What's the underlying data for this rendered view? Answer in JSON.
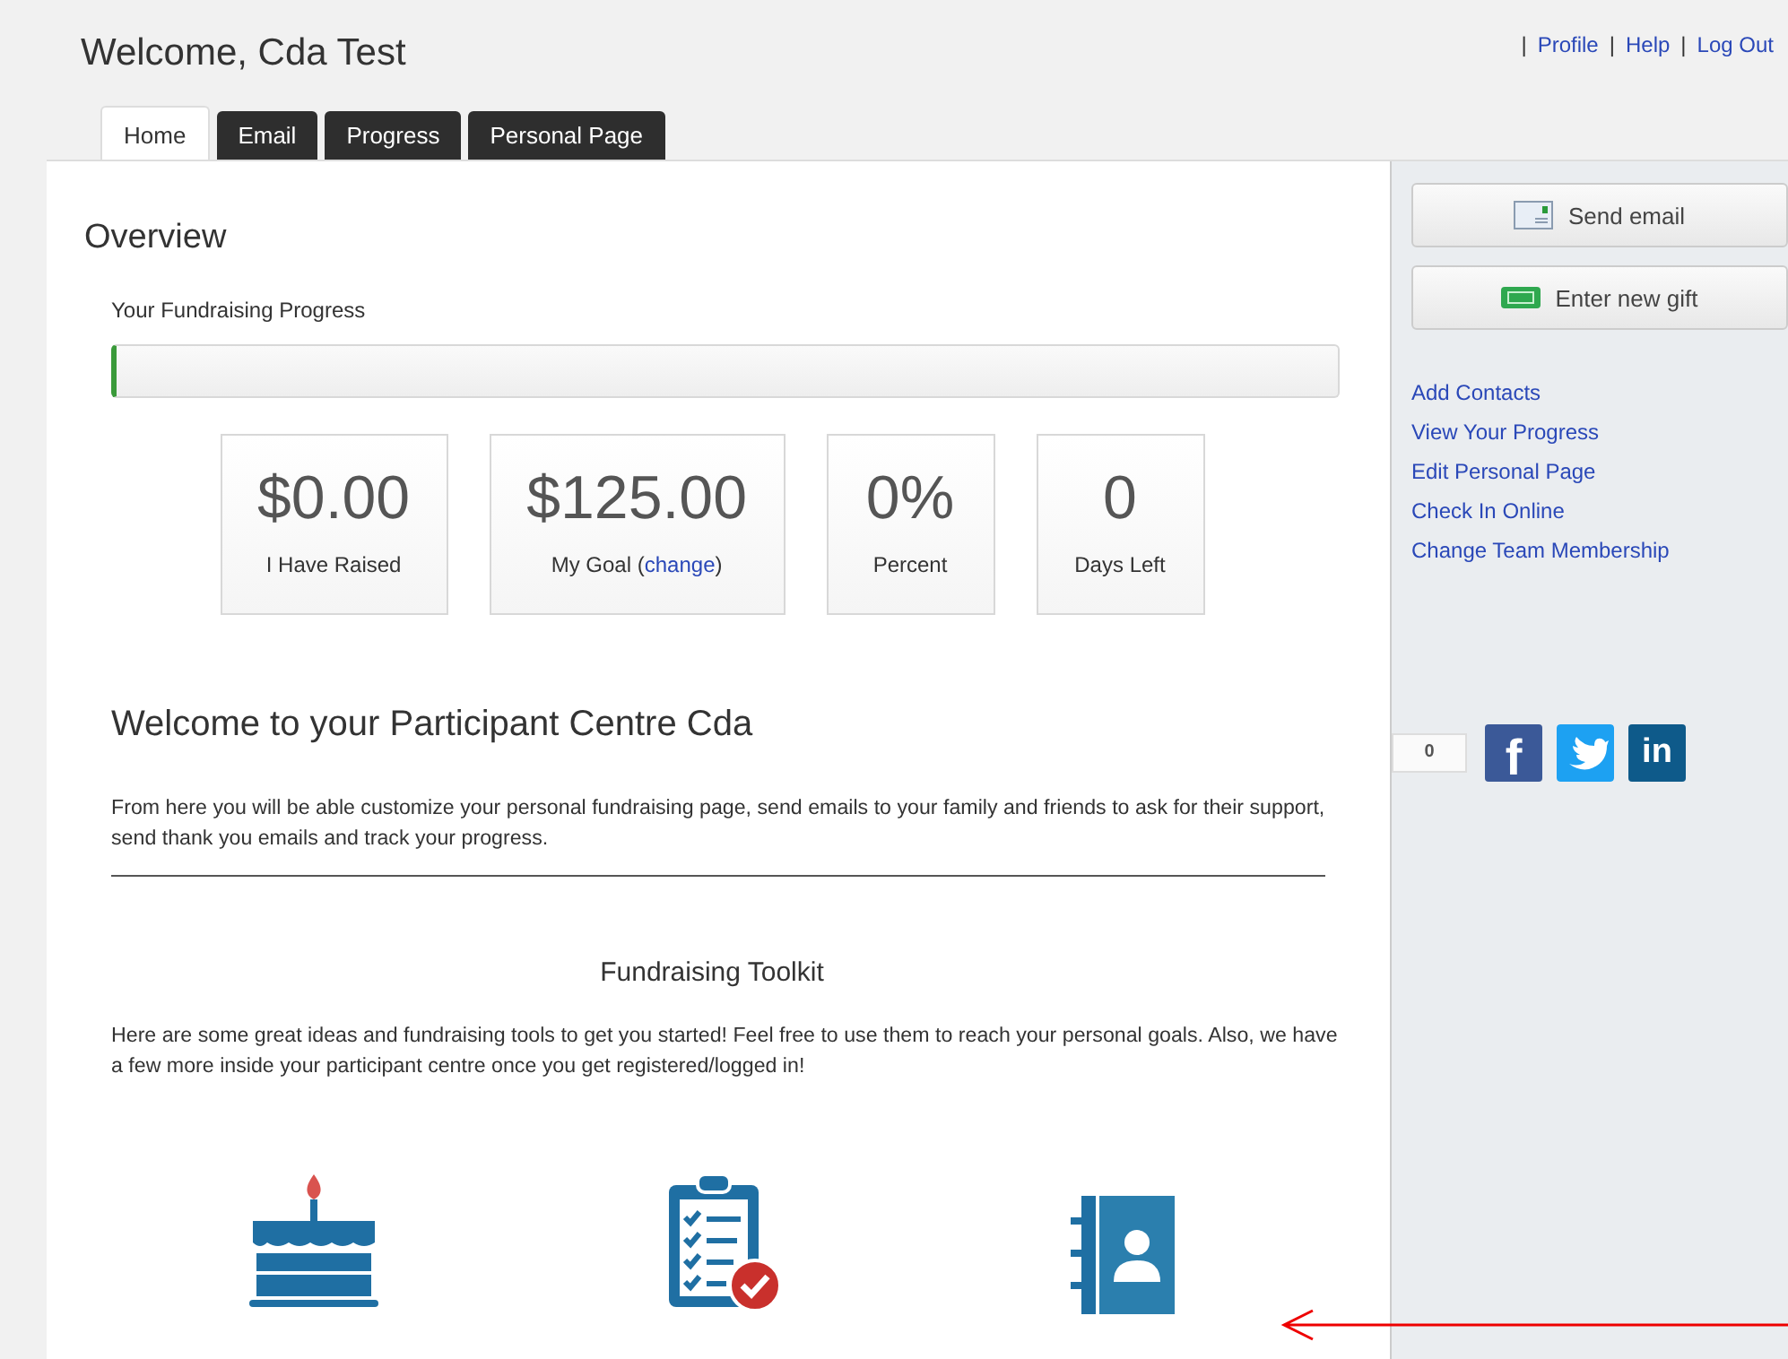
{
  "header": {
    "greeting": "Welcome, Cda Test",
    "link_separator": "|",
    "links": [
      "Profile",
      "Help",
      "Log Out"
    ]
  },
  "tabs": [
    {
      "label": "Home",
      "selected": true
    },
    {
      "label": "Email",
      "selected": false
    },
    {
      "label": "Progress",
      "selected": false
    },
    {
      "label": "Personal Page",
      "selected": false
    }
  ],
  "overview": {
    "title": "Overview",
    "progress_label": "Your Fundraising Progress",
    "level": 0,
    "stats": [
      {
        "value": "$0.00",
        "label": "I Have Raised"
      },
      {
        "value": "$125.00",
        "label": "My Goal",
        "link_open": "(",
        "link": "change",
        "link_close": ")"
      },
      {
        "value": "0%",
        "label": "Percent"
      },
      {
        "value": "0",
        "label": "Days Left"
      }
    ]
  },
  "welcome": {
    "title": "Welcome to your Participant Centre Cda",
    "text": "From here you will be able customize your personal fundraising page, send emails to your family and friends to ask for their support, send thank you emails and track your progress."
  },
  "toolkit": {
    "title": "Fundraising Toolkit",
    "text": "Here are some great ideas and fundraising tools to get you started! Feel free to use them to reach your personal goals. Also, we have a few more inside your participant centre once you get registered/logged in!",
    "tools": [
      {
        "kind": "cake"
      },
      {
        "kind": "clipboard"
      },
      {
        "kind": "contacts"
      }
    ]
  },
  "sidebar": {
    "buttons": [
      {
        "kind": "email",
        "label": "Send email"
      },
      {
        "kind": "gift",
        "label": "Enter new gift"
      }
    ],
    "links": [
      "Add Contacts",
      "View Your Progress",
      "Edit Personal Page",
      "Check In Online",
      "Change Team Membership"
    ],
    "share_count": "0",
    "share_buttons": [
      {
        "kind": "facebook",
        "glyph": "f"
      },
      {
        "kind": "twitter"
      },
      {
        "kind": "linkedin",
        "glyph": "in"
      }
    ]
  }
}
